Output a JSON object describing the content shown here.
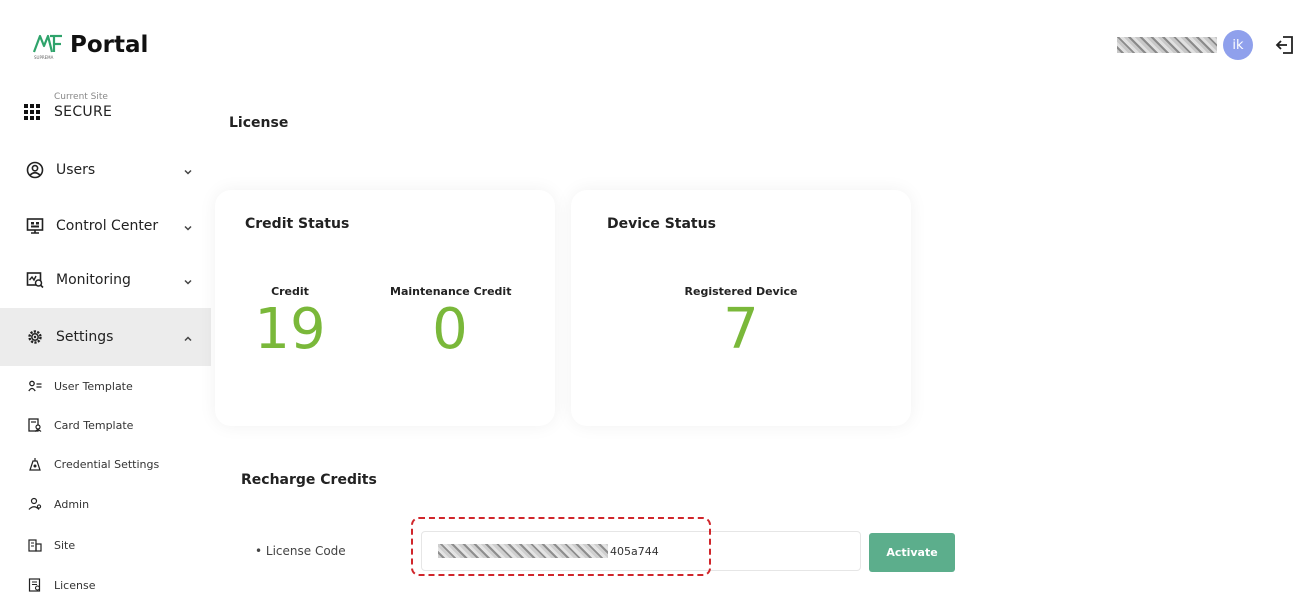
{
  "app": {
    "logo_text": "Portal",
    "logo_sub": "SUPREMA",
    "avatar_initials": "ik"
  },
  "sidebar": {
    "site_caption": "Current Site",
    "site_name": "SECURE",
    "nav": [
      {
        "label": "Users",
        "icon": "user-circle-icon"
      },
      {
        "label": "Control Center",
        "icon": "monitor-icon"
      },
      {
        "label": "Monitoring",
        "icon": "monitoring-icon"
      },
      {
        "label": "Settings",
        "icon": "gear-icon"
      }
    ],
    "sub_items": [
      {
        "label": "User Template",
        "icon": "user-list-icon"
      },
      {
        "label": "Card Template",
        "icon": "card-template-icon"
      },
      {
        "label": "Credential Settings",
        "icon": "credential-icon"
      },
      {
        "label": "Admin",
        "icon": "admin-icon"
      },
      {
        "label": "Site",
        "icon": "site-icon"
      },
      {
        "label": "License",
        "icon": "license-icon"
      }
    ]
  },
  "main": {
    "page_title": "License",
    "credit_card": {
      "title": "Credit Status",
      "credit_label": "Credit",
      "credit_value": "19",
      "maintenance_label": "Maintenance Credit",
      "maintenance_value": "0"
    },
    "device_card": {
      "title": "Device Status",
      "registered_label": "Registered Device",
      "registered_value": "7"
    },
    "recharge": {
      "title": "Recharge Credits",
      "license_label": "License Code",
      "license_value_suffix": "405a744",
      "activate_label": "Activate"
    }
  },
  "colors": {
    "accent_green": "#7ab83a",
    "button_green": "#5cae8c",
    "avatar": "#8fa0ec",
    "highlight_red": "#d0262b",
    "active_bg": "#ececec"
  }
}
